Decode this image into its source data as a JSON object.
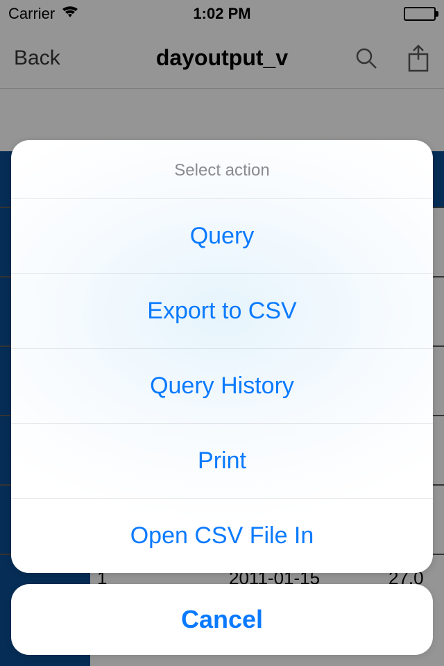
{
  "status": {
    "carrier": "Carrier",
    "time": "1:02 PM"
  },
  "nav": {
    "back": "Back",
    "title": "dayoutput_v"
  },
  "bg_row": {
    "c1": "1",
    "c2": "2011-01-15",
    "c3": "27.0"
  },
  "sheet": {
    "title": "Select action",
    "items": [
      "Query",
      "Export to CSV",
      "Query History",
      "Print",
      "Open CSV File In"
    ],
    "cancel": "Cancel"
  }
}
